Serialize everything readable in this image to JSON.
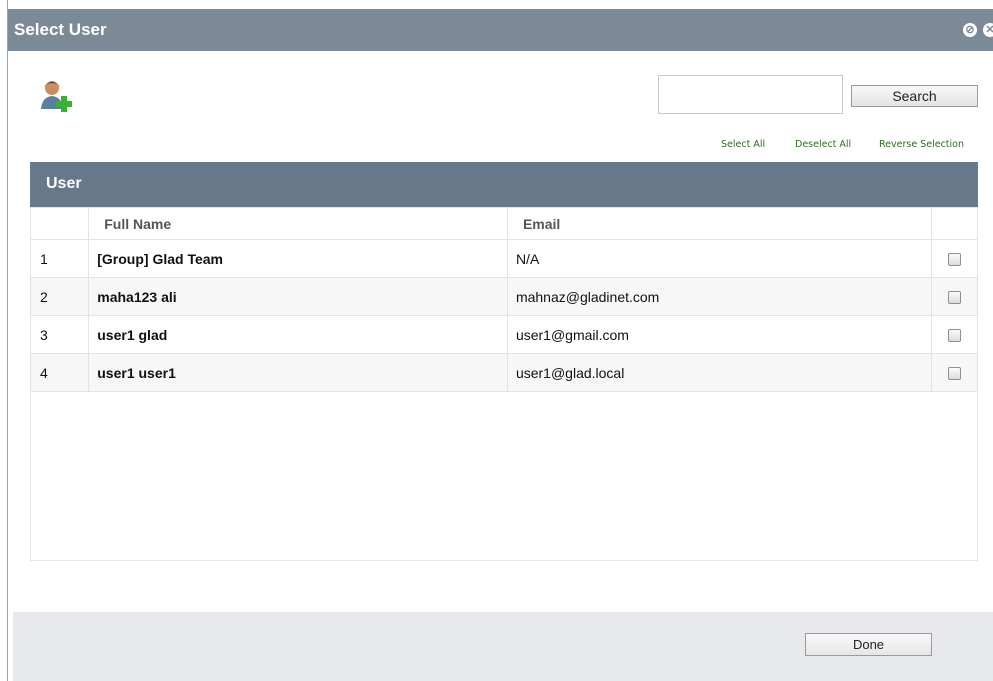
{
  "dialog": {
    "title": "Select User"
  },
  "toolbar": {
    "search_placeholder": "",
    "search_label": "Search",
    "select_all": "Select All",
    "deselect_all": "Deselect All",
    "reverse_selection": "Reverse Selection"
  },
  "icons": {
    "add_user": "user-add-icon",
    "title_buttons": [
      "block-icon",
      "close-icon"
    ]
  },
  "grid": {
    "title": "User",
    "columns": [
      "",
      "Full Name",
      "Email",
      ""
    ],
    "rows": [
      {
        "num": "1",
        "name": "[Group] Glad Team",
        "email": "N/A",
        "checked": false
      },
      {
        "num": "2",
        "name": "maha123 ali",
        "email": "mahnaz@gladinet.com",
        "checked": false
      },
      {
        "num": "3",
        "name": "user1 glad",
        "email": "user1@gmail.com",
        "checked": false
      },
      {
        "num": "4",
        "name": "user1 user1",
        "email": "user1@glad.local",
        "checked": false
      }
    ]
  },
  "footer": {
    "done_label": "Done"
  },
  "colors": {
    "titlebar": "#7b8a96",
    "grid_header": "#66788a",
    "link": "#2f6b1f",
    "footer": "#e7e9ec"
  }
}
